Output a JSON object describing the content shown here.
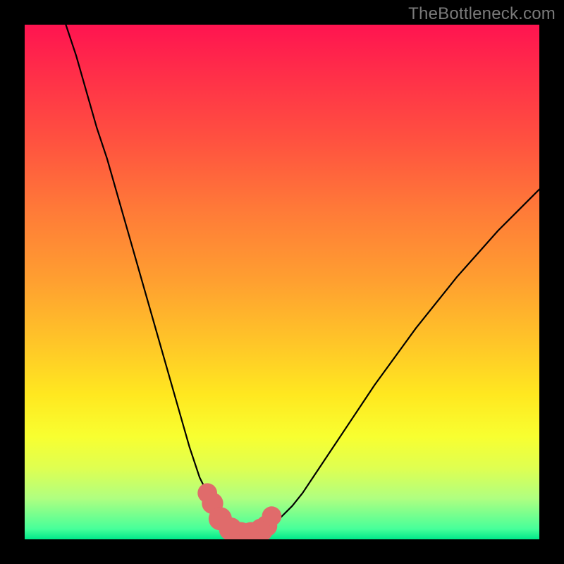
{
  "watermark": "TheBottleneck.com",
  "colors": {
    "frame": "#000000",
    "curve": "#000000",
    "markers_fill": "#e06b6b",
    "markers_stroke": "#c85a5a",
    "gradient_top": "#ff1450",
    "gradient_bottom": "#00e88a"
  },
  "chart_data": {
    "type": "line",
    "title": "",
    "xlabel": "",
    "ylabel": "",
    "xlim": [
      0,
      100
    ],
    "ylim": [
      0,
      100
    ],
    "grid": false,
    "legend": false,
    "series": [
      {
        "name": "bottleneck-curve",
        "x": [
          8,
          10,
          12,
          14,
          16,
          18,
          20,
          22,
          24,
          26,
          28,
          30,
          32,
          33,
          34,
          35,
          36,
          37,
          38,
          39,
          40,
          41,
          42,
          43,
          44,
          45,
          46,
          48,
          50,
          52,
          54,
          56,
          58,
          60,
          64,
          68,
          72,
          76,
          80,
          84,
          88,
          92,
          96,
          100
        ],
        "y": [
          100,
          94,
          87,
          80,
          74,
          67,
          60,
          53,
          46,
          39,
          32,
          25,
          18,
          15,
          12,
          10,
          7.5,
          5.5,
          4,
          2.8,
          2,
          1.5,
          1.2,
          1,
          1,
          1.2,
          1.6,
          2.8,
          4.5,
          6.5,
          9,
          12,
          15,
          18,
          24,
          30,
          35.5,
          41,
          46,
          51,
          55.5,
          60,
          64,
          68
        ]
      }
    ],
    "markers": {
      "name": "highlight-points",
      "x": [
        35.5,
        36.5,
        38,
        40,
        42,
        44,
        46,
        47,
        48
      ],
      "y": [
        9,
        7,
        4,
        2,
        1.1,
        1.1,
        1.8,
        2.6,
        4.5
      ],
      "r": [
        1.2,
        1.4,
        1.6,
        1.6,
        1.6,
        1.6,
        1.6,
        1.4,
        1.2
      ]
    }
  }
}
